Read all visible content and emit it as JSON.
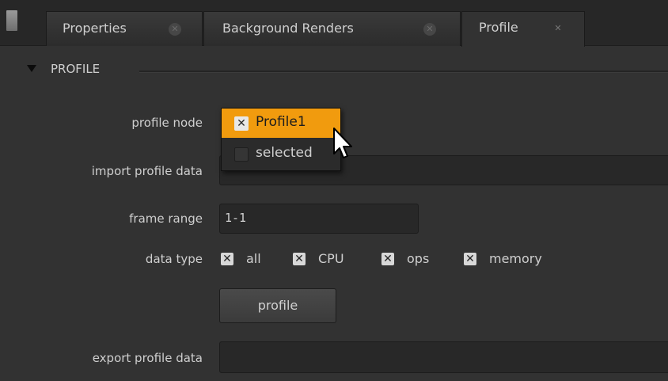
{
  "tabs": [
    {
      "label": "Properties",
      "close_icon": "close-circle-icon"
    },
    {
      "label": "Background Renders",
      "close_icon": "close-circle-icon"
    },
    {
      "label": "Profile",
      "close_icon": "close-x-icon",
      "active": true
    }
  ],
  "section": {
    "title": "PROFILE"
  },
  "fields": {
    "profile_node": {
      "label": "profile node"
    },
    "import_profile_data": {
      "label": "import profile data",
      "value": ""
    },
    "frame_range": {
      "label": "frame range",
      "value": "1-1"
    },
    "data_type": {
      "label": "data type",
      "options": [
        {
          "label": "all",
          "checked": true
        },
        {
          "label": "CPU",
          "checked": true
        },
        {
          "label": "ops",
          "checked": true
        },
        {
          "label": "memory",
          "checked": true
        }
      ]
    },
    "export_profile_data": {
      "label": "export profile data",
      "value": ""
    }
  },
  "profile_button": {
    "label": "profile"
  },
  "dropdown": {
    "items": [
      {
        "label": "Profile1",
        "checked": true,
        "highlighted": true
      },
      {
        "label": "selected",
        "checked": false
      }
    ]
  },
  "colors": {
    "accent": "#f19b0e",
    "panel": "#323232",
    "tabbar": "#272727"
  }
}
